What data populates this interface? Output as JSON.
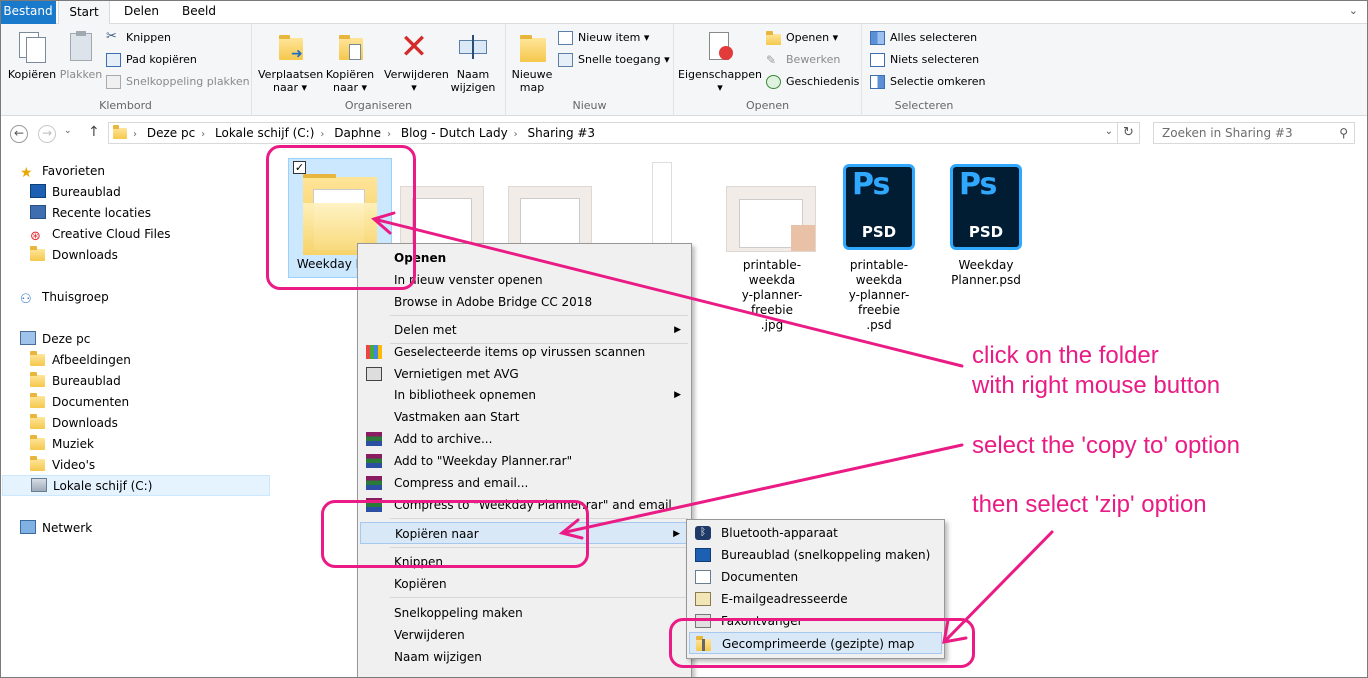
{
  "ribbon": {
    "tabs": [
      "Bestand",
      "Start",
      "Delen",
      "Beeld"
    ],
    "klembord": {
      "label": "Klembord",
      "copy": "Kopiëren",
      "paste": "Plakken",
      "cut": "Knippen",
      "copy_path": "Pad kopiëren",
      "paste_shortcut": "Snelkoppeling plakken"
    },
    "organiseren": {
      "label": "Organiseren",
      "move_to": "Verplaatsen naar",
      "copy_to": "Kopiëren naar",
      "delete": "Verwijderen",
      "rename": "Naam wijzigen"
    },
    "nieuw": {
      "label": "Nieuw",
      "new_folder": "Nieuwe map",
      "new_item": "Nieuw item",
      "quick_access": "Snelle toegang"
    },
    "openen": {
      "label": "Openen",
      "properties": "Eigenschappen",
      "open": "Openen",
      "edit": "Bewerken",
      "history": "Geschiedenis"
    },
    "selecteren": {
      "label": "Selecteren",
      "select_all": "Alles selecteren",
      "select_none": "Niets selecteren",
      "invert": "Selectie omkeren"
    }
  },
  "address": {
    "crumbs": [
      "Deze pc",
      "Lokale schijf (C:)",
      "Daphne",
      "Blog - Dutch Lady",
      "Sharing #3"
    ],
    "search_placeholder": "Zoeken in Sharing #3"
  },
  "nav": {
    "favorites": "Favorieten",
    "fav_items": [
      "Bureaublad",
      "Recente locaties",
      "Creative Cloud Files",
      "Downloads"
    ],
    "homegroup": "Thuisgroep",
    "this_pc": "Deze pc",
    "pc_items": [
      "Afbeeldingen",
      "Bureaublad",
      "Documenten",
      "Downloads",
      "Muziek",
      "Video's",
      "Lokale schijf (C:)"
    ],
    "network": "Netwerk"
  },
  "files": [
    {
      "name": "Weekday Plan",
      "type": "folder"
    },
    {
      "name": "printable-weekday-planner-freebie.jpg",
      "line1": "printable-weekda",
      "line2": "y-planner-freebie",
      "line3": ".jpg"
    },
    {
      "name": "printable-weekday-planner-freebie.psd",
      "line1": "printable-weekda",
      "line2": "y-planner-freebie",
      "line3": ".psd",
      "badge": "Ps",
      "tag": "PSD"
    },
    {
      "name": "Weekday Planner.psd",
      "line1": "Weekday",
      "line2": "Planner.psd",
      "badge": "Ps",
      "tag": "PSD"
    }
  ],
  "context_menu": {
    "items": [
      "Openen",
      "In nieuw venster openen",
      "Browse in Adobe Bridge CC 2018",
      "Delen met",
      "Geselecteerde items op virussen scannen",
      "Vernietigen met AVG",
      "In bibliotheek opnemen",
      "Vastmaken aan Start",
      "Add to archive...",
      "Add to \"Weekday Planner.rar\"",
      "Compress and email...",
      "Compress to \"Weekday Planner.rar\" and email",
      "Kopiëren naar",
      "Knippen",
      "Kopiëren",
      "Snelkoppeling maken",
      "Verwijderen",
      "Naam wijzigen"
    ]
  },
  "submenu": {
    "items": [
      "Bluetooth-apparaat",
      "Bureaublad (snelkoppeling maken)",
      "Documenten",
      "E-mailgeadresseerde",
      "Faxontvanger",
      "Gecomprimeerde (gezipte) map"
    ]
  },
  "annotations": {
    "note1_line1": "click on the folder",
    "note1_line2": "with right mouse button",
    "note2": "select the 'copy to' option",
    "note3": "then select 'zip' option",
    "color": "#ea1b84"
  },
  "colors": {
    "file_tab": "#1979ca",
    "selection": "#cce8ff",
    "ps_blue": "#31a8ff",
    "ps_bg": "#001d34"
  }
}
